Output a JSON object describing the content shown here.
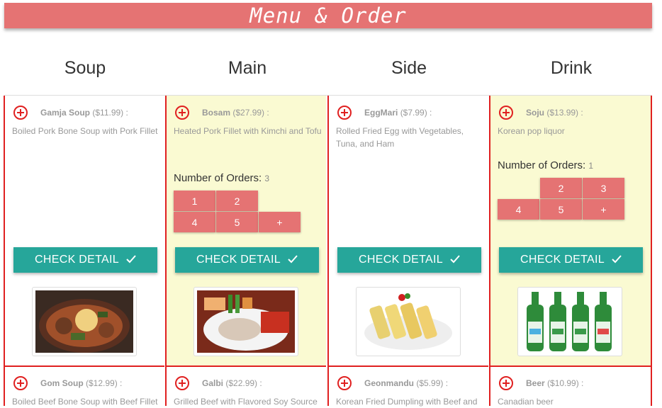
{
  "title": "Menu & Order",
  "categories": [
    "Soup",
    "Main",
    "Side",
    "Drink"
  ],
  "check_label": "CHECK DETAIL",
  "orders_label": "Number of Orders:",
  "items": [
    {
      "name": "Gamja Soup",
      "price": "($11.99) :",
      "desc": "Boiled Pork Bone Soup with Pork Fillet",
      "photo": "gamja-soup-photo"
    },
    {
      "name": "Bosam",
      "price": "($27.99) :",
      "desc": "Heated Pork Fillet with Kimchi and Tofu",
      "orders": "3",
      "qty": [
        "1",
        "2",
        "4",
        "5",
        "+"
      ],
      "photo": "bosam-photo"
    },
    {
      "name": "EggMari",
      "price": "($7.99) :",
      "desc": "Rolled Fried Egg with Vegetables, Tuna, and Ham",
      "photo": "eggmari-photo"
    },
    {
      "name": "Soju",
      "price": "($13.99) :",
      "desc": "Korean pop liquor",
      "orders": "1",
      "qty": [
        "2",
        "3",
        "4",
        "5",
        "+"
      ],
      "photo": "soju-photo"
    }
  ],
  "items_row2": [
    {
      "name": "Gom Soup",
      "price": "($12.99) :",
      "desc": "Boiled Beef Bone Soup with Beef Fillet"
    },
    {
      "name": "Galbi",
      "price": "($22.99) :",
      "desc": "Grilled Beef with Flavored Soy Source"
    },
    {
      "name": "Geonmandu",
      "price": "($5.99) :",
      "desc": "Korean Fried Dumpling with Beef and"
    },
    {
      "name": "Beer",
      "price": "($10.99) :",
      "desc": "Canadian beer"
    }
  ],
  "colors": {
    "accent": "#e57373",
    "teal": "#26a69a",
    "red": "#e02020",
    "selected": "#fafad2"
  }
}
